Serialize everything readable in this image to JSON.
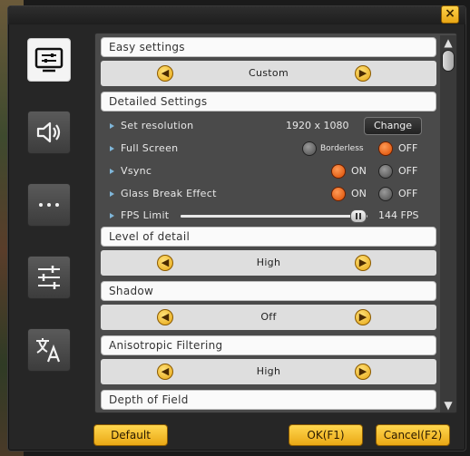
{
  "window": {
    "close_glyph": "×"
  },
  "sidebar": {
    "items": [
      {
        "name": "display-settings",
        "icon": "monitor-icon",
        "active": true
      },
      {
        "name": "sound-settings",
        "icon": "speaker-icon",
        "active": false
      },
      {
        "name": "more-settings",
        "icon": "ellipsis-icon",
        "active": false
      },
      {
        "name": "control-settings",
        "icon": "sliders-icon",
        "active": false
      },
      {
        "name": "language-settings",
        "icon": "translate-icon",
        "active": false
      }
    ]
  },
  "sections": {
    "easy": {
      "label": "Easy settings",
      "value": "Custom"
    },
    "detailed": {
      "label": "Detailed Settings"
    },
    "level_of_detail": {
      "label": "Level of detail",
      "value": "High"
    },
    "shadow": {
      "label": "Shadow",
      "value": "Off"
    },
    "aniso": {
      "label": "Anisotropic Filtering",
      "value": "High"
    },
    "dof": {
      "label": "Depth of Field"
    }
  },
  "settings": {
    "resolution": {
      "label": "Set resolution",
      "value": "1920 x 1080",
      "button": "Change"
    },
    "fullscreen": {
      "label": "Full Screen",
      "option_a": "Borderless",
      "option_b": "OFF",
      "selected": "OFF"
    },
    "vsync": {
      "label": "Vsync",
      "option_on": "ON",
      "option_off": "OFF",
      "selected": "ON"
    },
    "glass": {
      "label": "Glass Break Effect",
      "option_on": "ON",
      "option_off": "OFF",
      "selected": "ON"
    },
    "fps": {
      "label": "FPS Limit",
      "value_label": "144 FPS",
      "level": 0.95
    }
  },
  "arrows": {
    "left": "◀",
    "right": "▶"
  },
  "scrollbar": {
    "up": "▲",
    "down": "▼"
  },
  "footer": {
    "default_label": "Default",
    "ok_label": "OK(F1)",
    "cancel_label": "Cancel(F2)"
  },
  "colors": {
    "accent": "#f0b020",
    "radio_on": "#e85a10",
    "panel": "#4a4a4a"
  }
}
